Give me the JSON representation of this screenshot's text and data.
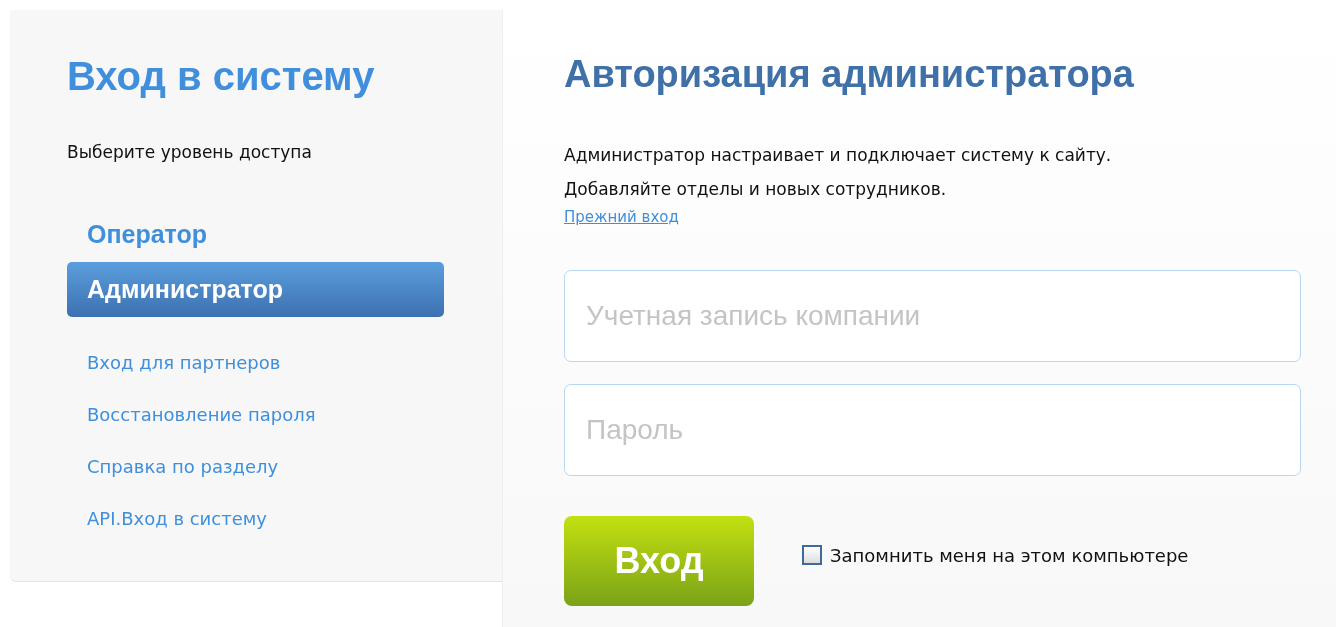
{
  "sidebar": {
    "title": "Вход в систему",
    "subtitle": "Выберите уровень доступа",
    "items": [
      {
        "kind": "level",
        "label": "Оператор",
        "selected": false
      },
      {
        "kind": "level",
        "label": "Администратор",
        "selected": true
      },
      {
        "kind": "link",
        "label": "Вход для партнеров"
      },
      {
        "kind": "link",
        "label": "Восстановление пароля"
      },
      {
        "kind": "link",
        "label": "Справка по разделу"
      },
      {
        "kind": "link",
        "label": "API.Вход в систему"
      }
    ]
  },
  "main": {
    "title": "Авторизация администратора",
    "description": [
      "Администратор настраивает и подключает систему к сайту.",
      "Добавляйте отделы и новых сотрудников."
    ],
    "legacy_link": "Прежний вход",
    "fields": [
      {
        "placeholder": "Учетная запись компании"
      },
      {
        "placeholder": "Пароль"
      }
    ],
    "submit": "Вход",
    "remember": {
      "label": "Запомнить меня на этом компьютере",
      "checked": false
    }
  }
}
